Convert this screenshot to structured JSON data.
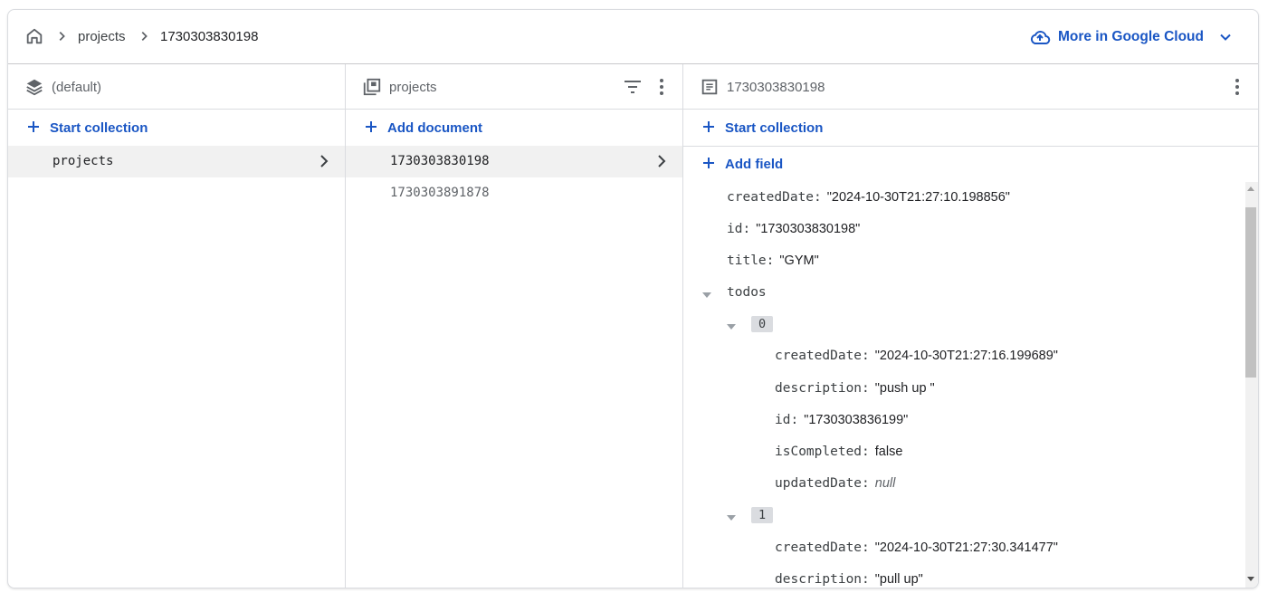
{
  "breadcrumb": {
    "home_icon": "home-icon",
    "items": [
      "projects",
      "1730303830198"
    ]
  },
  "cloud_link": {
    "label": "More in Google Cloud",
    "icon": "cloud-icon"
  },
  "colors": {
    "accent": "#1a56c4",
    "selected_row": "#f1f1f1",
    "muted": "#5f6368"
  },
  "col1": {
    "header": "(default)",
    "action": "Start collection",
    "items": [
      "projects"
    ]
  },
  "col2": {
    "header": "projects",
    "action": "Add document",
    "items": [
      "1730303830198",
      "1730303891878"
    ]
  },
  "col3": {
    "header": "1730303830198",
    "action_collection": "Start collection",
    "action_field": "Add field",
    "fields": {
      "createdDate": {
        "key": "createdDate:",
        "value": "\"2024-10-30T21:27:10.198856\""
      },
      "id": {
        "key": "id:",
        "value": "\"1730303830198\""
      },
      "title": {
        "key": "title:",
        "value": "\"GYM\""
      },
      "todos": {
        "key": "todos"
      },
      "todo0": {
        "index": "0",
        "createdDate": {
          "key": "createdDate:",
          "value": "\"2024-10-30T21:27:16.199689\""
        },
        "description": {
          "key": "description:",
          "value": "\"push up \""
        },
        "id": {
          "key": "id:",
          "value": "\"1730303836199\""
        },
        "isCompleted": {
          "key": "isCompleted:",
          "value": "false"
        },
        "updatedDate": {
          "key": "updatedDate:",
          "value": "null"
        }
      },
      "todo1": {
        "index": "1",
        "createdDate": {
          "key": "createdDate:",
          "value": "\"2024-10-30T21:27:30.341477\""
        },
        "description": {
          "key": "description:",
          "value": "\"pull up\""
        }
      }
    }
  }
}
